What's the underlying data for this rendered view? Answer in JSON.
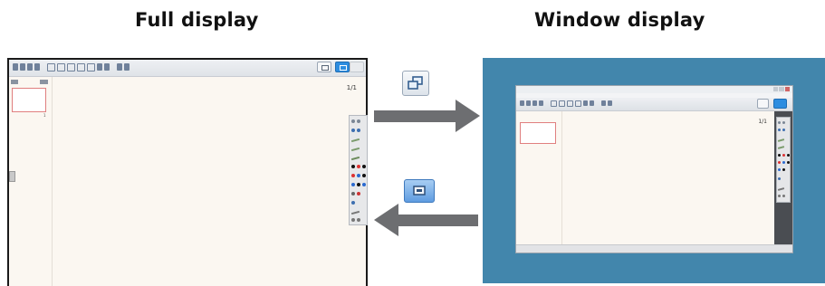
{
  "headings": {
    "full": "Full display",
    "window": "Window display"
  },
  "full_display": {
    "page_counter": "1/1",
    "toolbar_icons": [
      "home-icon",
      "home-icon",
      "document-icon",
      "save-icon",
      "page-icon",
      "page-icon",
      "page-icon",
      "page-icon",
      "page-icon",
      "arrow-up-icon",
      "arrow-down-icon",
      "settings-icon",
      "people-icon"
    ]
  },
  "window_display": {
    "page_counter": "1/1"
  },
  "buttons": {
    "restore_window": "restore-window-icon",
    "full_screen": "full-screen-icon"
  },
  "colors": {
    "accent_blue": "#2d8de0",
    "desktop_blue": "#4286ac",
    "arrow_gray": "#6d6e71",
    "canvas_cream": "#fbf7f1",
    "thumb_red": "#e07f7f"
  }
}
